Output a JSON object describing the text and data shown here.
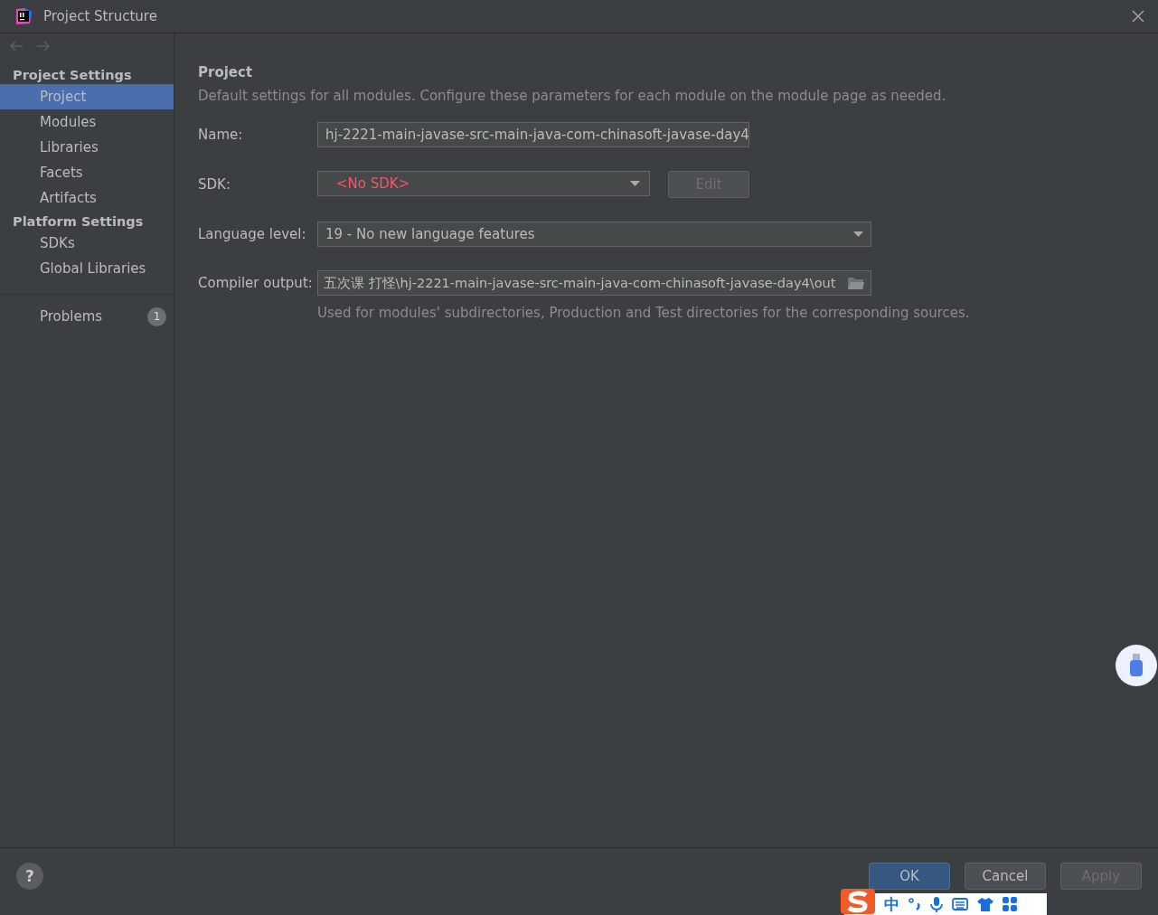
{
  "window": {
    "title": "Project Structure"
  },
  "nav": {
    "back_disabled": true,
    "forward_disabled": true
  },
  "sidebar": {
    "groups": [
      {
        "title": "Project Settings",
        "items": [
          {
            "label": "Project",
            "selected": true
          },
          {
            "label": "Modules",
            "selected": false
          },
          {
            "label": "Libraries",
            "selected": false
          },
          {
            "label": "Facets",
            "selected": false
          },
          {
            "label": "Artifacts",
            "selected": false
          }
        ]
      },
      {
        "title": "Platform Settings",
        "items": [
          {
            "label": "SDKs",
            "selected": false
          },
          {
            "label": "Global Libraries",
            "selected": false
          }
        ]
      }
    ],
    "problems": {
      "label": "Problems",
      "count": "1",
      "selected": false
    }
  },
  "content": {
    "title": "Project",
    "description": "Default settings for all modules. Configure these parameters for each module on the module page as needed.",
    "fields": [
      {
        "kind": "text",
        "label": "Name:",
        "value": "hj-2221-main-javase-src-main-java-com-chinasoft-javase-day4"
      },
      {
        "kind": "sdk",
        "label": "SDK:",
        "value": "<No SDK>",
        "error": true,
        "button": {
          "label": "Edit",
          "disabled": true
        }
      },
      {
        "kind": "select",
        "label": "Language level:",
        "value": "19 - No new language features"
      },
      {
        "kind": "path",
        "label": "Compiler output:",
        "value": "五次课  打怪\\hj-2221-main-javase-src-main-java-com-chinasoft-javase-day4\\out",
        "hint": "Used for modules' subdirectories, Production and Test directories for the corresponding sources."
      }
    ]
  },
  "footer": {
    "help": "?",
    "buttons": [
      {
        "label": "OK",
        "kind": "primary",
        "disabled": false
      },
      {
        "label": "Cancel",
        "kind": "normal",
        "disabled": false
      },
      {
        "label": "Apply",
        "kind": "normal",
        "disabled": true
      }
    ]
  },
  "ime_toolbar": {
    "mode": "中"
  }
}
